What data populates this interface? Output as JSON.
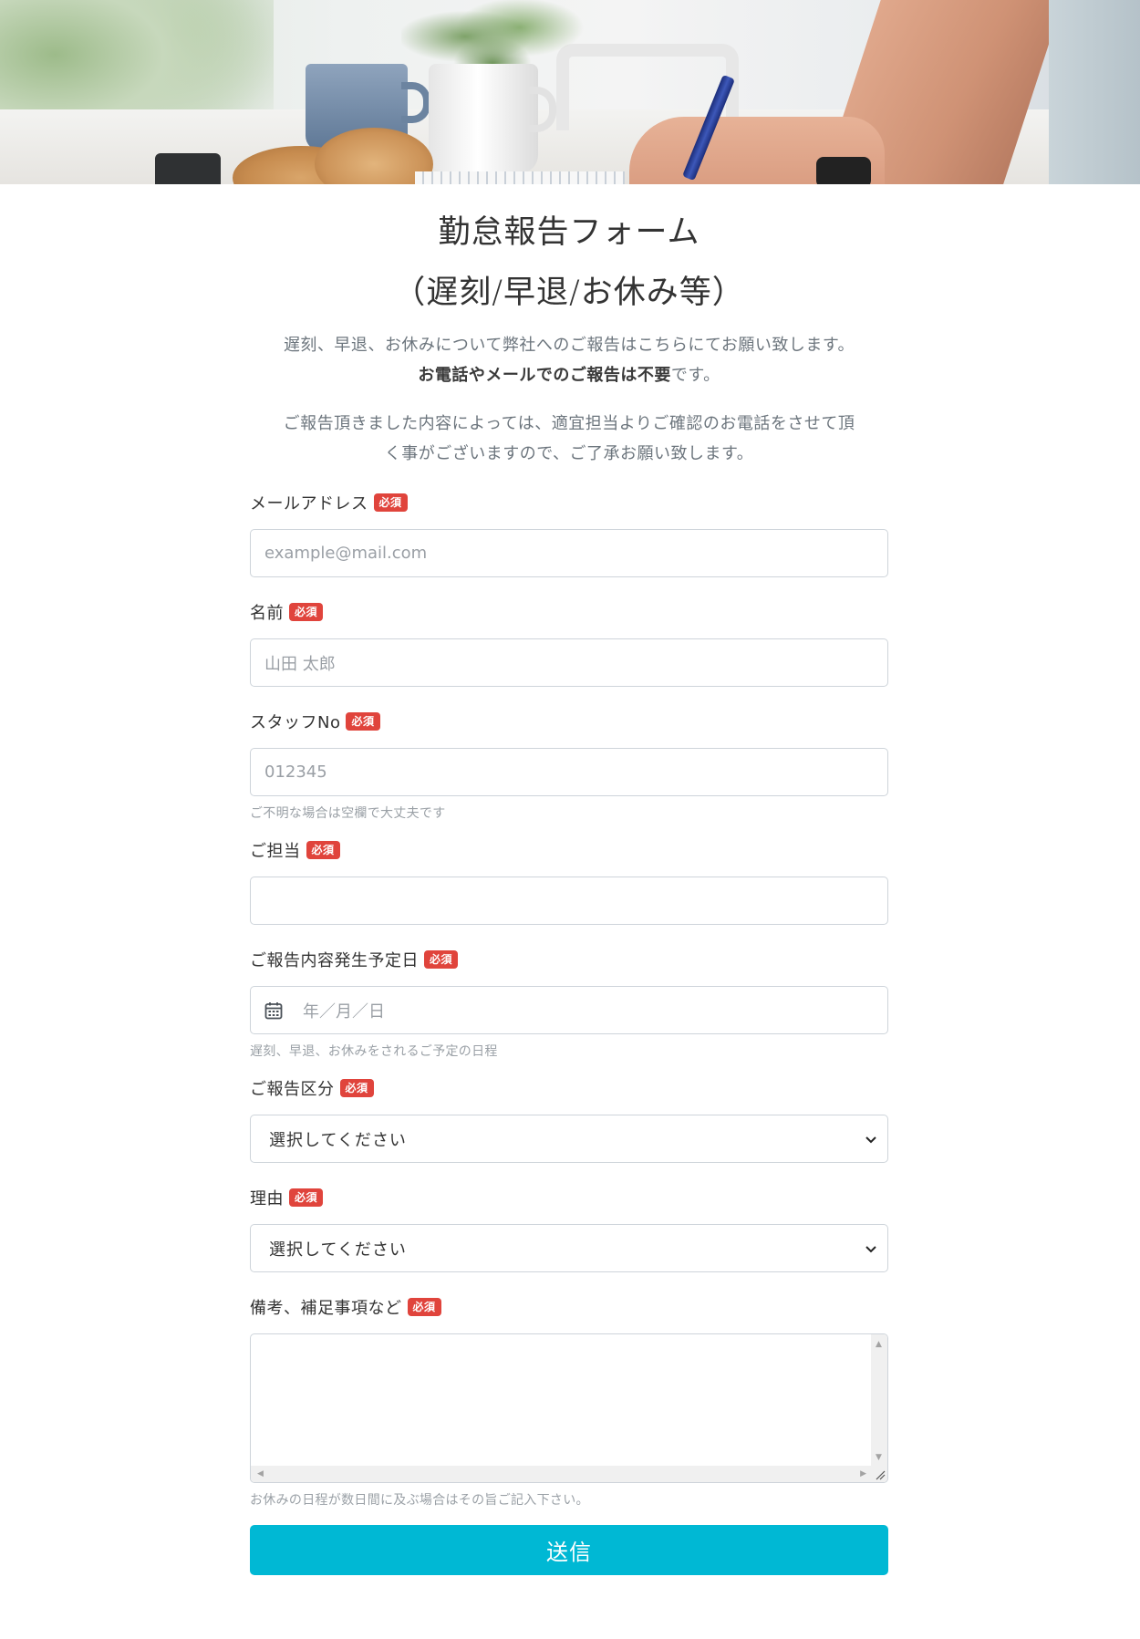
{
  "page": {
    "title_line1": "勤怠報告フォーム",
    "title_line2": "（遅刻/早退/お休み等）",
    "intro_line1": "遅刻、早退、お休みについて弊社へのご報告はこちらにてお願い致します。",
    "intro_bold": "お電話やメールでのご報告は不要",
    "intro_suffix": "です。",
    "notice_line1": "ご報告頂きました内容によっては、適宜担当よりご確認のお電話をさせて頂",
    "notice_line2": "く事がございますので、ご了承お願い致します。"
  },
  "required_badge": "必須",
  "fields": {
    "email": {
      "label": "メールアドレス",
      "placeholder": "example@mail.com"
    },
    "name": {
      "label": "名前",
      "placeholder": "山田 太郎"
    },
    "staff_no": {
      "label": "スタッフNo",
      "placeholder": "012345",
      "hint": "ご不明な場合は空欄で大丈夫です"
    },
    "contact": {
      "label": "ご担当",
      "placeholder": ""
    },
    "date": {
      "label": "ご報告内容発生予定日",
      "placeholder": "年／月／日",
      "hint": "遅刻、早退、お休みをされるご予定の日程"
    },
    "category": {
      "label": "ご報告区分",
      "selected": "選択してください"
    },
    "reason": {
      "label": "理由",
      "selected": "選択してください"
    },
    "remarks": {
      "label": "備考、補足事項など",
      "hint": "お休みの日程が数日間に及ぶ場合はその旨ご記入下さい。"
    }
  },
  "submit_label": "送信",
  "colors": {
    "accent": "#00b8d4",
    "badge": "#e0443c"
  },
  "icons": {
    "date": "calendar-icon",
    "select": "chevron-down-icon"
  }
}
